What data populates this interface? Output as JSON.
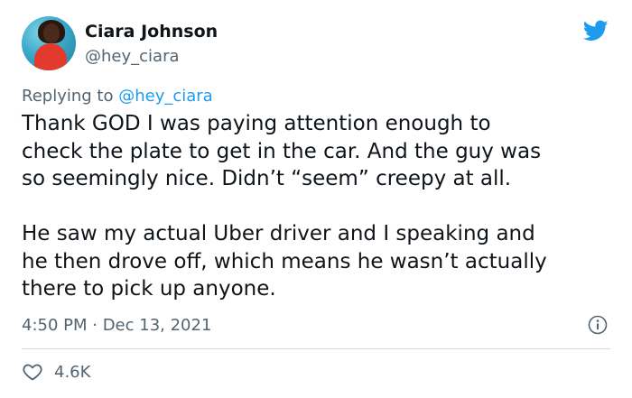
{
  "author": {
    "name": "Ciara Johnson",
    "handle": "@hey_ciara",
    "avatar_icon": "profile-photo"
  },
  "reply": {
    "prefix": "Replying to",
    "handle": "@hey_ciara"
  },
  "tweet": {
    "lines": [
      "Thank GOD I was paying attention enough to",
      "check the plate to get in the car. And the guy was",
      "so seemingly nice. Didn’t “seem” creepy at all.",
      "He saw my actual Uber driver and I speaking and",
      "he then drove off, which means he wasn’t actually",
      "there to pick up anyone."
    ]
  },
  "meta": {
    "timestamp": "4:50 PM · Dec 13, 2021"
  },
  "engagement": {
    "likes": "4.6K"
  },
  "colors": {
    "brand": "#1d9bf0",
    "text": "#0f1419",
    "muted": "#536471",
    "divider": "#cfd9de"
  }
}
